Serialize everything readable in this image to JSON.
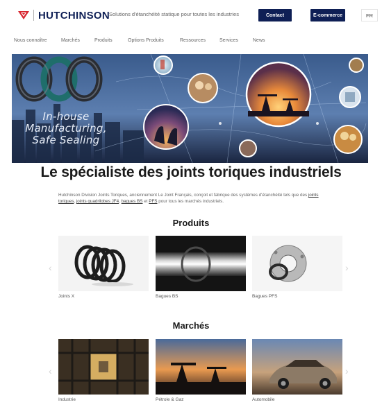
{
  "header": {
    "brand": "HUTCHINSON",
    "tagline": "Solutions d'étanchéité statique pour toutes les industries",
    "contact_label": "Contact",
    "ecommerce_label": "E-commerce",
    "language": "FR"
  },
  "nav": {
    "items": [
      "Nous connaître",
      "Marchés",
      "Produits",
      "Options Produits",
      "Ressources",
      "Services",
      "News"
    ]
  },
  "hero": {
    "line1": "In-house",
    "line2": "Manufacturing,",
    "line3": "Safe Sealing"
  },
  "main": {
    "title": "Le spécialiste des joints toriques industriels",
    "intro_part1": "Hutchinson Division Joints Toriques, anciennement Le Joint Français, conçoit et fabrique des systèmes d'étanchéité",
    "intro_part2": "tels que des",
    "intro_link1": "joints toriques",
    "intro_link2": "joints quadrilobes JF4",
    "intro_link3": "bagues BS",
    "intro_and": "et",
    "intro_link4": "PFS",
    "intro_end": "pour tous les marchés industriels."
  },
  "produits": {
    "title": "Produits",
    "items": [
      {
        "label": "Joints X"
      },
      {
        "label": "Bagues BS"
      },
      {
        "label": "Bagues PFS"
      }
    ]
  },
  "marches": {
    "title": "Marchés",
    "items": [
      {
        "label": "Industrie"
      },
      {
        "label": "Pétrole & Gaz"
      },
      {
        "label": "Automobile"
      }
    ]
  },
  "colors": {
    "brand_navy": "#0e1f55",
    "brand_red": "#d8262f"
  }
}
